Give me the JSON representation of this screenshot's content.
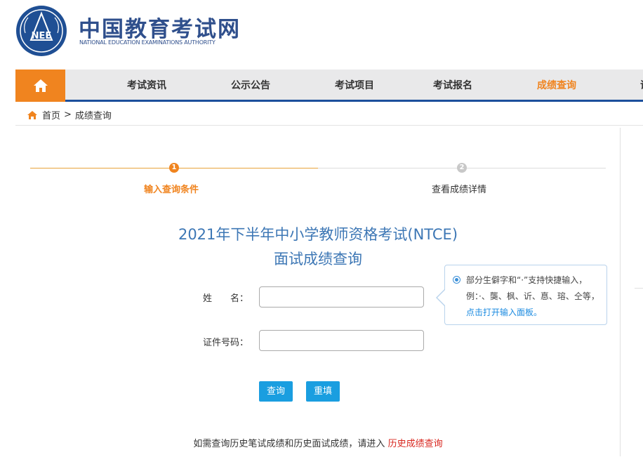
{
  "header": {
    "logo_text": "NEE",
    "site_title": "中国教育考试网",
    "site_subtitle": "NATIONAL EDUCATION EXAMINATIONS AUTHORITY"
  },
  "nav": {
    "items": [
      {
        "label": "考试资讯"
      },
      {
        "label": "公示公告"
      },
      {
        "label": "考试项目"
      },
      {
        "label": "考试报名"
      },
      {
        "label": "成绩查询"
      },
      {
        "label": "证"
      }
    ],
    "active_index": 4,
    "accent_color": "#f0841f",
    "bar_color": "#1c4f9c"
  },
  "breadcrumb": {
    "home": "首页",
    "separator": ">",
    "current": "成绩查询"
  },
  "steps": [
    {
      "number": "1",
      "label": "输入查询条件",
      "active": true
    },
    {
      "number": "2",
      "label": "查看成绩详情",
      "active": false
    }
  ],
  "title": {
    "line1": "2021年下半年中小学教师资格考试(NTCE)",
    "line2": "面试成绩查询"
  },
  "form": {
    "name_label": "姓　　名：",
    "name_value": "",
    "id_label": "证件号码：",
    "id_value": "",
    "query_button": "查询",
    "reset_button": "重填"
  },
  "tooltip": {
    "text": "部分生僻字和“·”支持快捷输入，例：·、龑、枫、䜣、惪、瑢、仝等，",
    "link": "点击打开输入面板。"
  },
  "bottom": {
    "text": "如需查询历史笔试成绩和历史面试成绩，请进入",
    "link": "历史成绩查询"
  }
}
